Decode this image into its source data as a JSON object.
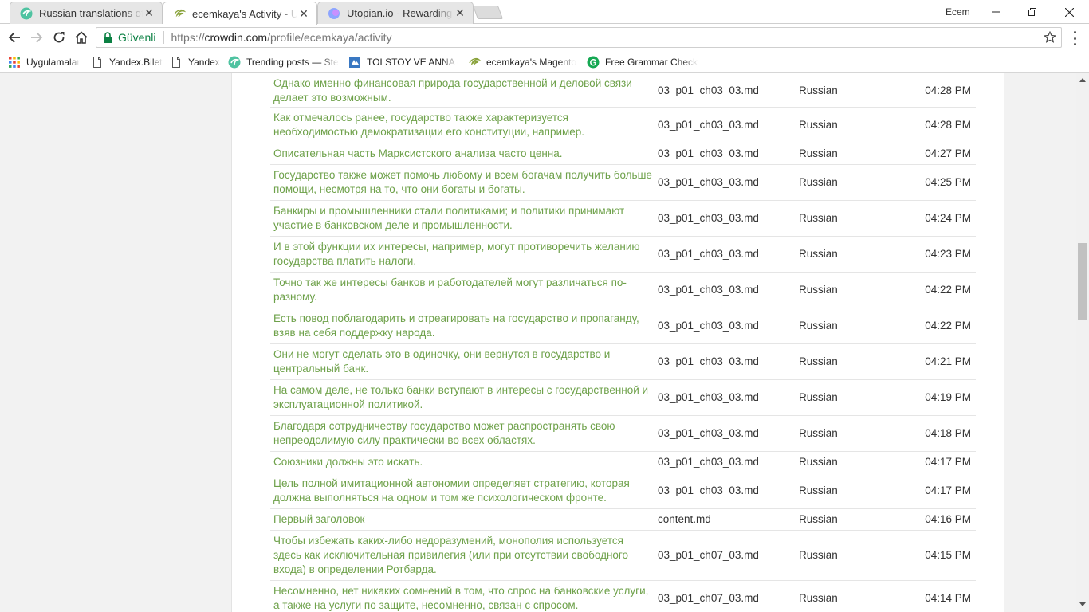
{
  "browser": {
    "tabs": [
      {
        "title": "Russian translations of M",
        "active": false
      },
      {
        "title": "ecemkaya's Activity - Use",
        "active": true
      },
      {
        "title": "Utopian.io - Rewarding O",
        "active": false
      }
    ],
    "profile_name": "Ecem",
    "secure_label": "Güvenli",
    "url": {
      "scheme": "https://",
      "host": "crowdin.com",
      "path": "/profile/ecemkaya/activity"
    },
    "bookmarks": [
      {
        "label": "Uygulamalar",
        "icon": "apps-grid-icon"
      },
      {
        "label": "Yandex.Bilet",
        "icon": "page-icon"
      },
      {
        "label": "Yandex",
        "icon": "page-icon"
      },
      {
        "label": "Trending posts — Ste",
        "icon": "steemit-icon"
      },
      {
        "label": "TOLSTOY VE ANNA -",
        "icon": "book-icon"
      },
      {
        "label": "ecemkaya's Magento",
        "icon": "crowdin-icon"
      },
      {
        "label": "Free Grammar Checke",
        "icon": "grammarly-icon"
      }
    ]
  },
  "activity": {
    "rows": [
      {
        "text": "Однако именно финансовая природа государственной и деловой связи делает это возможным.",
        "file": "03_p01_ch03_03.md",
        "language": "Russian",
        "time": "04:28 PM"
      },
      {
        "text": "Как отмечалось ранее, государство также характеризуется необходимостью демократизации его конституции, например.",
        "file": "03_p01_ch03_03.md",
        "language": "Russian",
        "time": "04:28 PM"
      },
      {
        "text": "Описательная часть Марксистского анализа часто ценна.",
        "file": "03_p01_ch03_03.md",
        "language": "Russian",
        "time": "04:27 PM"
      },
      {
        "text": "Государство также может помочь любому и всем богачам получить больше помощи, несмотря на то, что они богаты и богаты.",
        "file": "03_p01_ch03_03.md",
        "language": "Russian",
        "time": "04:25 PM"
      },
      {
        "text": "Банкиры и промышленники стали политиками; и политики принимают участие в банковском деле и промышленности.",
        "file": "03_p01_ch03_03.md",
        "language": "Russian",
        "time": "04:24 PM"
      },
      {
        "text": "И в этой функции их интересы, например, могут противоречить желанию государства платить налоги.",
        "file": "03_p01_ch03_03.md",
        "language": "Russian",
        "time": "04:23 PM"
      },
      {
        "text": "Точно так же интересы банков и работодателей могут различаться по-разному.",
        "file": "03_p01_ch03_03.md",
        "language": "Russian",
        "time": "04:22 PM"
      },
      {
        "text": "Есть повод поблагодарить и отреагировать на государство и пропаганду, взяв на себя поддержку народа.",
        "file": "03_p01_ch03_03.md",
        "language": "Russian",
        "time": "04:22 PM"
      },
      {
        "text": "Они не могут сделать это в одиночку, они вернутся в государство и центральный банк.",
        "file": "03_p01_ch03_03.md",
        "language": "Russian",
        "time": "04:21 PM"
      },
      {
        "text": "На самом деле, не только банки вступают в интересы с государственной и эксплуатационной политикой.",
        "file": "03_p01_ch03_03.md",
        "language": "Russian",
        "time": "04:19 PM"
      },
      {
        "text": "Благодаря сотрудничеству государство может распространять свою непреодолимую силу практически во всех областях.",
        "file": "03_p01_ch03_03.md",
        "language": "Russian",
        "time": "04:18 PM"
      },
      {
        "text": "Союзники должны это искать.",
        "file": "03_p01_ch03_03.md",
        "language": "Russian",
        "time": "04:17 PM"
      },
      {
        "text": "Цель полной имитационной автономии определяет стратегию, которая должна выполняться на одном и том же психологическом фронте.",
        "file": "03_p01_ch03_03.md",
        "language": "Russian",
        "time": "04:17 PM"
      },
      {
        "text": "Первый заголовок",
        "file": "content.md",
        "language": "Russian",
        "time": "04:16 PM"
      },
      {
        "text": "Чтобы избежать каких-либо недоразумений, монополия используется здесь как исключительная привилегия (или при отсутствии свободного входа) в определении Ротбарда.",
        "file": "03_p01_ch07_03.md",
        "language": "Russian",
        "time": "04:15 PM"
      },
      {
        "text": "Несомненно, нет никаких сомнений в том, что спрос на банковские услуги, а также на услуги по защите, несомненно, связан с спросом.",
        "file": "03_p01_ch07_03.md",
        "language": "Russian",
        "time": "04:14 PM"
      }
    ]
  },
  "colors": {
    "link_green": "#6ea14a",
    "secure_green": "#0b8043"
  }
}
